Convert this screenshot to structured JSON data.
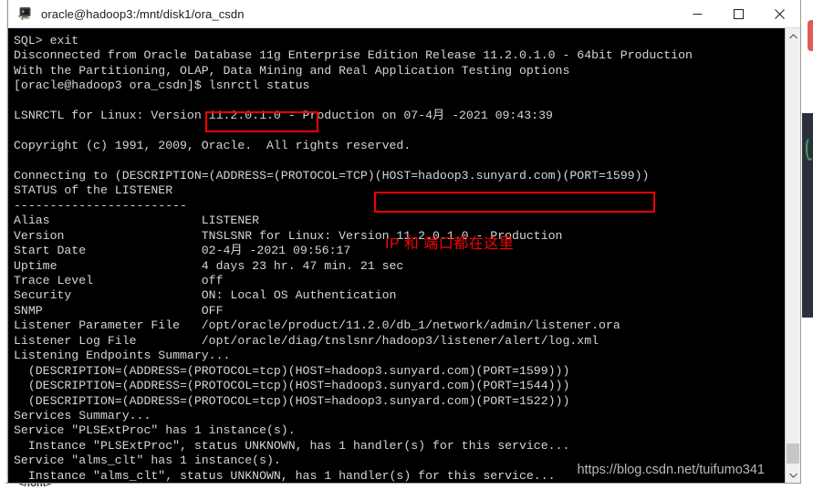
{
  "window": {
    "title": "oracle@hadoop3:/mnt/disk1/ora_csdn",
    "icon": "terminal-shortcut-icon",
    "minimize_label": "—",
    "maximize_label": "□",
    "close_label": "✕"
  },
  "terminal": {
    "background": "#000000",
    "foreground": "#d6d6d6",
    "lines": [
      "SQL> exit",
      "Disconnected from Oracle Database 11g Enterprise Edition Release 11.2.0.1.0 - 64bit Production",
      "With the Partitioning, OLAP, Data Mining and Real Application Testing options",
      "[oracle@hadoop3 ora_csdn]$ lsnrctl status",
      "",
      "LSNRCTL for Linux: Version 11.2.0.1.0 - Production on 07-4月 -2021 09:43:39",
      "",
      "Copyright (c) 1991, 2009, Oracle.  All rights reserved.",
      "",
      "Connecting to (DESCRIPTION=(ADDRESS=(PROTOCOL=TCP)(HOST=hadoop3.sunyard.com)(PORT=1599))",
      "STATUS of the LISTENER",
      "------------------------",
      "Alias                     LISTENER",
      "Version                   TNSLSNR for Linux: Version 11.2.0.1.0 - Production",
      "Start Date                02-4月 -2021 09:56:17",
      "Uptime                    4 days 23 hr. 47 min. 21 sec",
      "Trace Level               off",
      "Security                  ON: Local OS Authentication",
      "SNMP                      OFF",
      "Listener Parameter File   /opt/oracle/product/11.2.0/db_1/network/admin/listener.ora",
      "Listener Log File         /opt/oracle/diag/tnslsnr/hadoop3/listener/alert/log.xml",
      "Listening Endpoints Summary...",
      "  (DESCRIPTION=(ADDRESS=(PROTOCOL=tcp)(HOST=hadoop3.sunyard.com)(PORT=1599)))",
      "  (DESCRIPTION=(ADDRESS=(PROTOCOL=tcp)(HOST=hadoop3.sunyard.com)(PORT=1544)))",
      "  (DESCRIPTION=(ADDRESS=(PROTOCOL=tcp)(HOST=hadoop3.sunyard.com)(PORT=1522)))",
      "Services Summary...",
      "Service \"PLSExtProc\" has 1 instance(s).",
      "  Instance \"PLSExtProc\", status UNKNOWN, has 1 handler(s) for this service...",
      "Service \"alms_clt\" has 1 instance(s).",
      "  Instance \"alms_clt\", status UNKNOWN, has 1 handler(s) for this service..."
    ]
  },
  "annotations": {
    "color": "#f40000",
    "box_command_label": "lsnrctl status",
    "box_hostport_label": "(HOST=hadoop3.sunyard.com)(PORT=1599))",
    "note_text": "IP 和 端口都在这里"
  },
  "scrollbar": {
    "up_arrow": "▲",
    "down_arrow": "▼"
  },
  "watermark": {
    "text": "https://blog.csdn.net/tuifumo341"
  },
  "background_page": {
    "bottom_markup": "</font>",
    "bottom_prefix": "~'"
  }
}
